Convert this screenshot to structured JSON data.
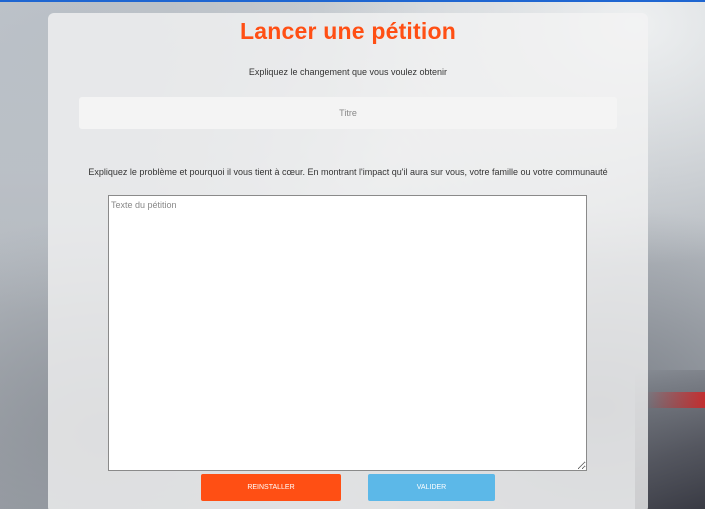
{
  "form": {
    "title": "Lancer une pétition",
    "subtitle": "Expliquez le changement que vous voulez obtenir",
    "title_field": {
      "placeholder": "Titre",
      "value": ""
    },
    "description": "Expliquez le problème et pourquoi il vous tient à cœur. En montrant l'impact qu'il aura sur vous, votre famille ou votre communauté",
    "text_field": {
      "placeholder": "Texte du pétition",
      "value": ""
    },
    "reset_label": "REINSTALLER",
    "submit_label": "VALIDER"
  },
  "colors": {
    "accent_orange": "#ff4f14",
    "accent_blue": "#5cb8e8",
    "top_strip": "#1f66d1"
  }
}
